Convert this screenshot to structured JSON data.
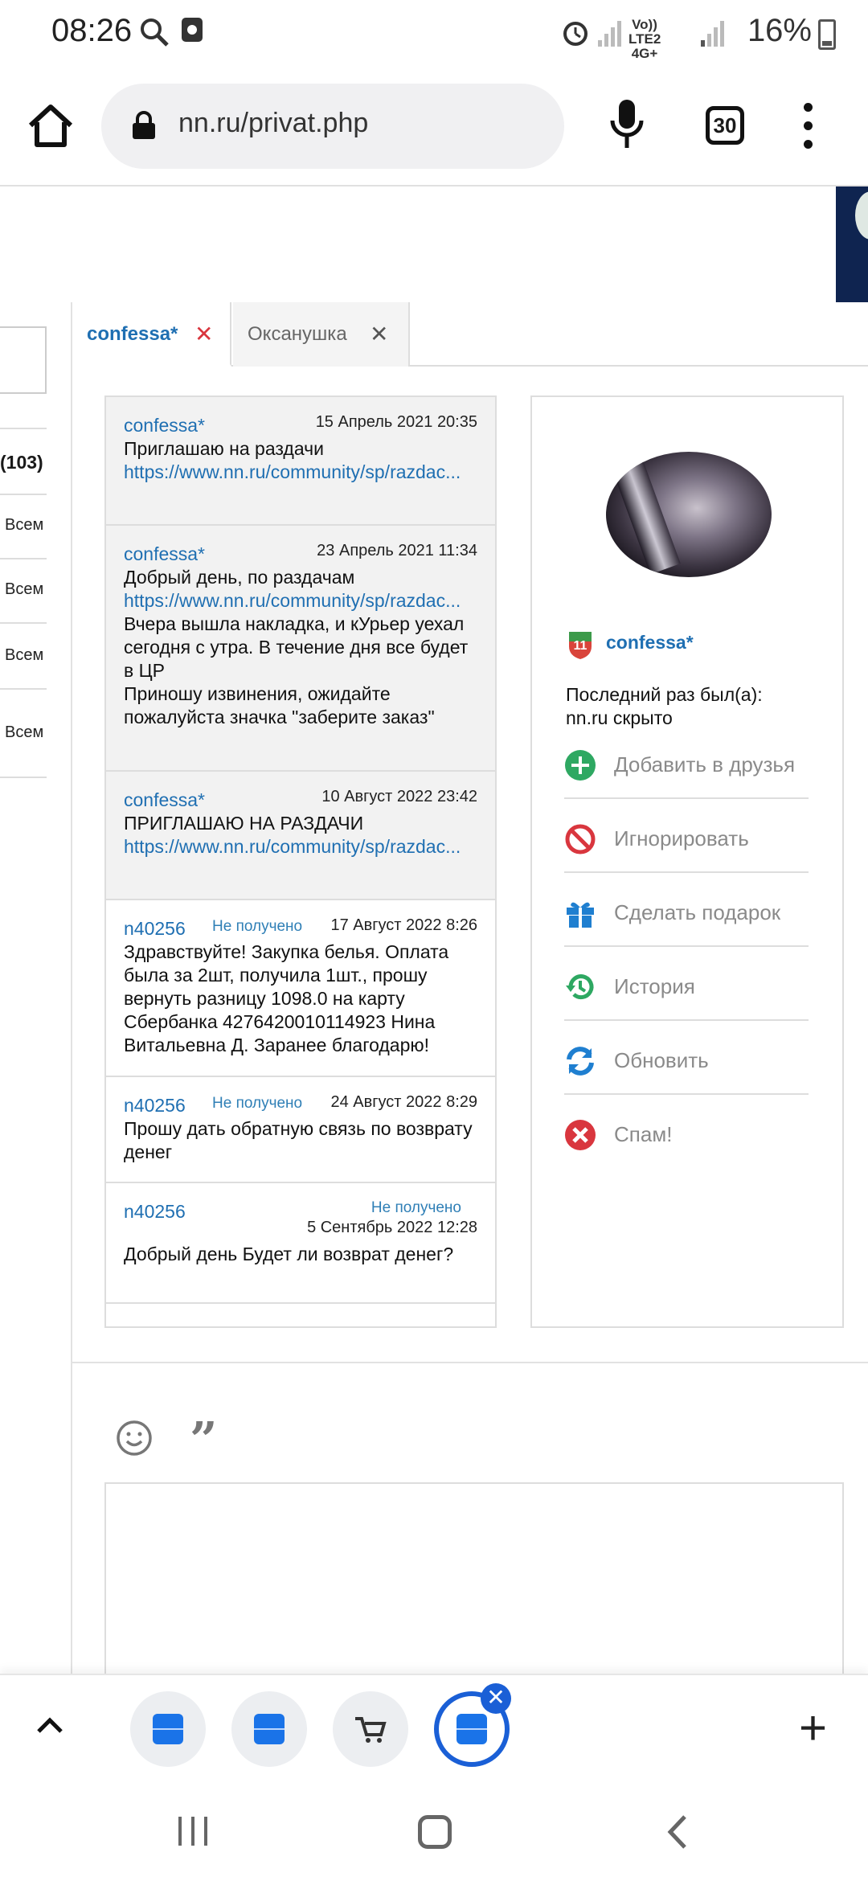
{
  "status_bar": {
    "time": "08:26",
    "network": "Vo)) LTE2 4G+",
    "battery": "16%"
  },
  "browser": {
    "url": "nn.ru/privat.php",
    "tab_count": "30"
  },
  "sidebar_partial": {
    "count": "(103)",
    "items": [
      "Всем",
      "Всем",
      "Всем",
      "Всем"
    ]
  },
  "tabs": [
    {
      "label": "confessa*",
      "active": true
    },
    {
      "label": "Оксанушка",
      "active": false
    }
  ],
  "messages": [
    {
      "author": "confessa*",
      "date": "15 Апрель 2021 20:35",
      "status": "",
      "text": "Приглашаю на раздачи",
      "link": "https://www.nn.ru/community/sp/razdac...",
      "text_after": ""
    },
    {
      "author": "confessa*",
      "date": "23 Апрель 2021 11:34",
      "status": "",
      "text": "Добрый день, по раздачам",
      "link": "https://www.nn.ru/community/sp/razdac...",
      "text_after": "Вчера вышла накладка, и кУрьер уехал сегодня с утра. В течение дня все будет в ЦР\nПриношу извинения, ожидайте пожалуйста значка \"заберите заказ\""
    },
    {
      "author": "confessa*",
      "date": "10 Август 2022 23:42",
      "status": "",
      "text": "ПРИГЛАШАЮ НА РАЗДАЧИ",
      "link": "https://www.nn.ru/community/sp/razdac...",
      "text_after": ""
    },
    {
      "author": "n40256",
      "date": "17 Август 2022 8:26",
      "status": "Не получено",
      "text": "Здравствуйте! Закупка белья. Оплата была за 2шт, получила 1шт., прошу вернуть разницу 1098.0 на карту Сбербанка 4276420010114923 Нина Витальевна Д. Заранее благодарю!",
      "link": "",
      "text_after": ""
    },
    {
      "author": "n40256",
      "date": "24 Август 2022 8:29",
      "status": "Не получено",
      "text": "Прошу дать обратную связь по возврату денег",
      "link": "",
      "text_after": ""
    },
    {
      "author": "n40256",
      "date": "5 Сентябрь 2022 12:28",
      "status": "Не получено",
      "text": "Добрый день Будет ли возврат денег?",
      "link": "",
      "text_after": ""
    }
  ],
  "profile": {
    "rank": "11",
    "name": "confessa*",
    "last_seen_label": "Последний раз был(а):",
    "last_seen_value": "nn.ru скрыто",
    "actions": [
      {
        "label": "Добавить в друзья",
        "icon": "add-friend-icon",
        "color": "#2ea862"
      },
      {
        "label": "Игнорировать",
        "icon": "ignore-icon",
        "color": "#d9363e"
      },
      {
        "label": "Сделать подарок",
        "icon": "gift-icon",
        "color": "#1f7fd0"
      },
      {
        "label": "История",
        "icon": "history-icon",
        "color": "#2ea862"
      },
      {
        "label": "Обновить",
        "icon": "refresh-icon",
        "color": "#1f7fd0"
      },
      {
        "label": "Спам!",
        "icon": "spam-icon",
        "color": "#d9363e"
      }
    ]
  },
  "colors": {
    "link": "#1f6fb2",
    "accent": "#1a5fd6"
  }
}
